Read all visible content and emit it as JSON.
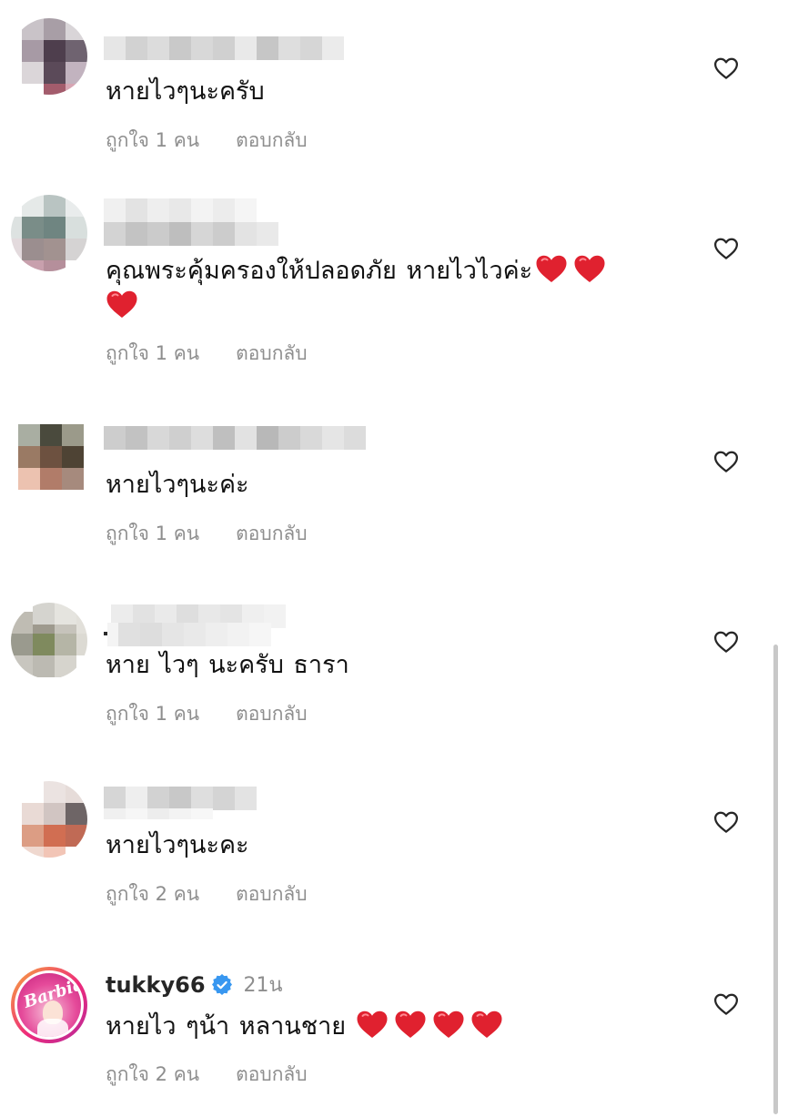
{
  "colors": {
    "meta_text": "#8e8e8e",
    "heart_emoji": "#e0212f",
    "verified": "#3897f0",
    "scrollbar": "#c8c8c8"
  },
  "comments": [
    {
      "username_blurred": true,
      "text_parts": [
        "หายไวๆนะครับ"
      ],
      "likes": "ถูกใจ 1 คน",
      "reply": "ตอบกลับ"
    },
    {
      "username_blurred": true,
      "text_parts": [
        "คุณพระคุ้มครองให้ปลอดภัย  หายไวไวค่ะ"
      ],
      "emoji": [
        "red-heart",
        "red-heart",
        "red-heart"
      ],
      "likes": "ถูกใจ 1 คน",
      "reply": "ตอบกลับ"
    },
    {
      "username_blurred": true,
      "text_parts": [
        "หายไวๆนะค่ะ"
      ],
      "likes": "ถูกใจ 1 คน",
      "reply": "ตอบกลับ"
    },
    {
      "username_blurred": true,
      "text_parts": [
        "หาย ไวๆ นะครับ ธารา"
      ],
      "likes": "ถูกใจ 1 คน",
      "reply": "ตอบกลับ"
    },
    {
      "username_blurred": true,
      "text_parts": [
        "หายไวๆนะคะ"
      ],
      "likes": "ถูกใจ 2 คน",
      "reply": "ตอบกลับ"
    },
    {
      "username": "tukky66",
      "verified": true,
      "time": "21น",
      "avatar_logo": "Barbie",
      "text_parts": [
        "หายไว ๆน้า หลานชาย"
      ],
      "emoji": [
        "red-heart",
        "red-heart",
        "red-heart",
        "red-heart"
      ],
      "likes": "ถูกใจ 2 คน",
      "reply": "ตอบกลับ"
    }
  ]
}
